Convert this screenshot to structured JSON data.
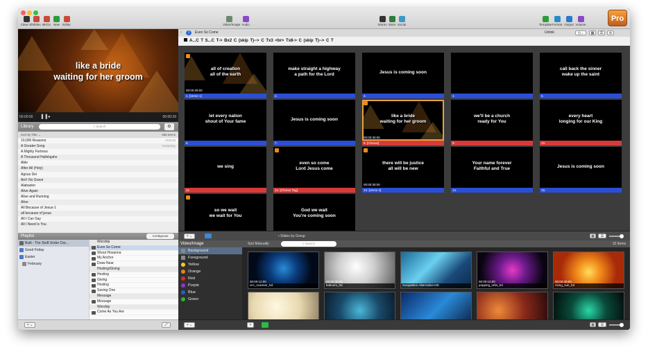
{
  "toolbar": {
    "left_buttons": [
      {
        "label": "Clear All",
        "color": "#333333"
      },
      {
        "label": "Slides",
        "color": "#c94a3a"
      },
      {
        "label": "BKGs",
        "color": "#c94a3a"
      },
      {
        "label": "New",
        "color": "#2e9b3e"
      },
      {
        "label": "Editor",
        "color": "#c94a3a"
      }
    ],
    "center_buttons": [
      {
        "label": "Video/Image",
        "color": "#6a8a70"
      },
      {
        "label": "Audio",
        "color": "#8a4ac8"
      }
    ],
    "mid_buttons": [
      {
        "label": "Stores",
        "color": "#333333"
      },
      {
        "label": "Store",
        "color": "#2e7d3a"
      },
      {
        "label": "Social",
        "color": "#3a9ac8"
      }
    ],
    "right_buttons": [
      {
        "label": "Template",
        "color": "#2e9b3e"
      },
      {
        "label": "Format",
        "color": "#2a8ac8"
      },
      {
        "label": "Output",
        "color": "#2a7ac8"
      },
      {
        "label": "Volume",
        "color": "#8a4ac8"
      }
    ],
    "pro_label": "Pro"
  },
  "preview": {
    "line1": "like a bride",
    "line2": "waiting for her groom",
    "time_start": "00:00:00",
    "time_end": "00:00:29"
  },
  "library": {
    "title": "Library",
    "search_placeholder": "Search",
    "sort_label": "Sort by Title",
    "count": "588 Items",
    "items": [
      {
        "name": "10,000 Reasons",
        "date": "3/11/15"
      },
      {
        "name": "A Greater Song",
        "date": "Yesterday"
      },
      {
        "name": "A Mighty Fortress",
        "date": ""
      },
      {
        "name": "A Thousand Hallelujahs",
        "date": ""
      },
      {
        "name": "Able",
        "date": ""
      },
      {
        "name": "After All (Holy)",
        "date": ""
      },
      {
        "name": "Agnus Dei",
        "date": ""
      },
      {
        "name": "Ain't No Grave",
        "date": ""
      },
      {
        "name": "Alabaster",
        "date": ""
      },
      {
        "name": "Alive Again",
        "date": ""
      },
      {
        "name": "Alive and Running",
        "date": ""
      },
      {
        "name": "Alive",
        "date": ""
      },
      {
        "name": "All Because of Jesus-1",
        "date": ""
      },
      {
        "name": "all because of jesus",
        "date": ""
      },
      {
        "name": "All I Can Say",
        "date": ""
      },
      {
        "name": "All I Need Is You",
        "date": ""
      }
    ]
  },
  "playlist": {
    "title": "Playlist",
    "button": "Contiguous",
    "left_items": [
      {
        "name": "Built - The Stuff Under Our..."
      },
      {
        "name": "Good Friday"
      },
      {
        "name": "Easter"
      },
      {
        "name": "February"
      }
    ],
    "right_items": [
      {
        "name": "Worship",
        "type": "hdr"
      },
      {
        "name": "Even So Come",
        "type": "sel"
      },
      {
        "name": "Shout Hosanna",
        "type": ""
      },
      {
        "name": "My Anchor",
        "type": ""
      },
      {
        "name": "Draw Near",
        "type": ""
      },
      {
        "name": "Hosting/Giving",
        "type": "hdr"
      },
      {
        "name": "Hosting",
        "type": ""
      },
      {
        "name": "Giving",
        "type": ""
      },
      {
        "name": "Hosting",
        "type": ""
      },
      {
        "name": "Saving One",
        "type": ""
      },
      {
        "name": "Message",
        "type": "hdr"
      },
      {
        "name": "Message",
        "type": ""
      },
      {
        "name": "Worship",
        "type": "hdr"
      },
      {
        "name": "Come As You Are",
        "type": ""
      }
    ]
  },
  "slideshow": {
    "title": "Even So Come",
    "unlink": "Unlink",
    "arrangement": "A...C T    S...C T->    Bx2    C (skip T)--> C  Tx3    <br>    Tx8-> C (skip T)--> C T",
    "slides": [
      {
        "text": "all of creation\nall of the earth",
        "label": "1. [Verse 1]",
        "bar": "#2a4fd6",
        "bg": "bg-fire",
        "tc": "00:00:29:00",
        "badge": true
      },
      {
        "text": "make straight a highway\na path for the Lord",
        "label": "2.",
        "bar": "#2a4fd6",
        "bg": "",
        "tc": "",
        "badge": false
      },
      {
        "text": "Jesus is coming soon",
        "label": "3.",
        "bar": "#2a4fd6",
        "bg": "",
        "tc": "",
        "badge": false
      },
      {
        "text": "",
        "label": "4.",
        "bar": "#2a4fd6",
        "bg": "",
        "tc": "",
        "badge": false
      },
      {
        "text": "call back the sinner\nwake up the saint",
        "label": "5.",
        "bar": "#2a4fd6",
        "bg": "",
        "tc": "",
        "badge": false
      },
      {
        "text": "let every nation\nshout of Your fame",
        "label": "6.",
        "bar": "#2a4fd6",
        "bg": "",
        "tc": "",
        "badge": false
      },
      {
        "text": "Jesus is coming soon",
        "label": "7.",
        "bar": "#2a4fd6",
        "bg": "",
        "tc": "",
        "badge": false
      },
      {
        "text": "like a bride\nwaiting for her groom",
        "label": "8. [Chorus]",
        "bar": "#d83a3a",
        "bg": "bg-tri",
        "tc": "00:00:30:00",
        "badge": true
      },
      {
        "text": "we'll be a church\nready for You",
        "label": "9.",
        "bar": "#d83a3a",
        "bg": "",
        "tc": "",
        "badge": false
      },
      {
        "text": "every heart\nlonging for our King",
        "label": "10.",
        "bar": "#d83a3a",
        "bg": "",
        "tc": "",
        "badge": false
      },
      {
        "text": "we sing",
        "label": "11.",
        "bar": "#d83a3a",
        "bg": "",
        "tc": "",
        "badge": false
      },
      {
        "text": "even so come\nLord Jesus come",
        "label": "12. [Chorus Tag]",
        "bar": "#d83a3a",
        "bg": "",
        "tc": "",
        "badge": true
      },
      {
        "text": "there will be justice\nall will be new",
        "label": "13. [Verse 2]",
        "bar": "#2a4fd6",
        "bg": "bg-red",
        "tc": "00:00:30:00",
        "badge": true
      },
      {
        "text": "Your name forever\nFaithful and True",
        "label": "14.",
        "bar": "#2a4fd6",
        "bg": "",
        "tc": "",
        "badge": false
      },
      {
        "text": "Jesus is coming soon",
        "label": "15.",
        "bar": "#2a4fd6",
        "bg": "",
        "tc": "",
        "badge": false
      },
      {
        "text": "so we wait\nwe wait for You",
        "label": "",
        "bar": "",
        "bg": "bg-orange",
        "tc": "00:00:30:00",
        "badge": true
      },
      {
        "text": "God we wait\nYou're coming soon",
        "label": "",
        "bar": "",
        "bg": "",
        "tc": "",
        "badge": false
      }
    ],
    "footer_label": "Slides by Group"
  },
  "video_image": {
    "title": "Video/Image",
    "sort_label": "Sort Manually",
    "search_placeholder": "Search",
    "count": "32 Items",
    "categories": [
      {
        "name": "Background",
        "color": "#8a8a8a",
        "sel": true
      },
      {
        "name": "Foreground",
        "color": "#8a8a8a",
        "sel": false
      },
      {
        "name": "Yellow",
        "color": "#e8d020",
        "sel": false
      },
      {
        "name": "Orange",
        "color": "#e88020",
        "sel": false
      },
      {
        "name": "Red",
        "color": "#d82a2a",
        "sel": false
      },
      {
        "name": "Purple",
        "color": "#8a3ac8",
        "sel": false
      },
      {
        "name": "Blue",
        "color": "#2a5ad8",
        "sel": false
      },
      {
        "name": "Green",
        "color": "#2ab82a",
        "sel": false
      }
    ],
    "media": [
      {
        "name": "circ_scanner_hd",
        "tc": "00:00:12;00",
        "bg": "radial-gradient(circle at 50% 45%,#2a8ad8 0%,#0a3a7a 35%,#020a1a 70%)"
      },
      {
        "name": "kaboom_hd",
        "tc": "00:00:30;00",
        "bg": "radial-gradient(circle at 45% 40%,#ffffff 0%,#cfcfcf 40%,#5a5a5a 100%)"
      },
      {
        "name": "Geopattern Alternative-HD",
        "tc": "",
        "bg": "linear-gradient(135deg,#1a6a9a 0%,#6ad0f0 40%,#1a4a7a 70%,#0a2a4a 100%)"
      },
      {
        "name": "popping_orbs_hd",
        "tc": "00:00:12;00",
        "bg": "radial-gradient(circle at 50% 50%,#e83ac8 0%,#6a1a8a 35%,#0a0410 80%)"
      },
      {
        "name": "rising_sun_hd",
        "tc": "00:00:30;00",
        "bg": "radial-gradient(circle at 50% 55%,#ffdd5a 0%,#f08a1a 30%,#a82a08 70%)"
      },
      {
        "name": "",
        "tc": "00:00:12;20",
        "bg": "radial-gradient(circle at 40% 40%,#fff8e0 0%,#e8d8b0 50%,#8a7a5a 100%)"
      },
      {
        "name": "",
        "tc": "00:00:30;00",
        "bg": "radial-gradient(circle at 50% 50%,#4ab8d8 0%,#1a4a6a 50%,#0a1a2a 100%)"
      },
      {
        "name": "",
        "tc": "00:00:15;00",
        "bg": "linear-gradient(135deg,#0a2a6a 0%,#2a8ad8 50%,#0a1a3a 100%)"
      },
      {
        "name": "",
        "tc": "00:00:10;00",
        "bg": "radial-gradient(circle at 30% 50%,#f08a3a 0%,#8a2a1a 50%,#2a0a0a 100%)"
      },
      {
        "name": "",
        "tc": "00:00:30;00",
        "bg": "radial-gradient(circle at 50% 50%,#2ad8a8 0%,#0a4a3a 45%,#020a08 100%)"
      }
    ]
  }
}
